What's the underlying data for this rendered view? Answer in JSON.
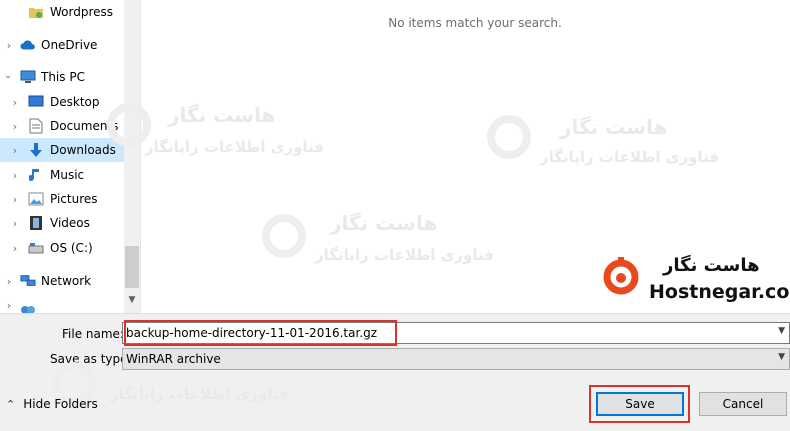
{
  "nav": {
    "items": [
      {
        "label": "Wordpress",
        "icon": "folder-wordpress-icon"
      },
      {
        "label": "OneDrive",
        "icon": "onedrive-cloud-icon"
      },
      {
        "label": "This PC",
        "icon": "computer-icon"
      },
      {
        "label": "Desktop",
        "icon": "desktop-icon"
      },
      {
        "label": "Documents",
        "icon": "documents-icon"
      },
      {
        "label": "Downloads",
        "icon": "downloads-arrow-icon"
      },
      {
        "label": "Music",
        "icon": "music-note-icon"
      },
      {
        "label": "Pictures",
        "icon": "pictures-icon"
      },
      {
        "label": "Videos",
        "icon": "videos-film-icon"
      },
      {
        "label": "OS (C:)",
        "icon": "drive-icon"
      },
      {
        "label": "Network",
        "icon": "network-icon"
      }
    ],
    "selected": "Downloads"
  },
  "content": {
    "empty_message": "No items match your search."
  },
  "watermark": {
    "line1": "هاست نگار",
    "line2": "فناوری اطلاعات رایانگار"
  },
  "brand": {
    "name_fa": "هاست نگار",
    "name_en": "Hostnegar.com",
    "accent": "#e8491d"
  },
  "form": {
    "filename_label": "File name:",
    "filename_value": "backup-home-directory-11-01-2016.tar.gz",
    "type_label": "Save as type:",
    "type_value": "WinRAR archive"
  },
  "footer": {
    "hide_folders_label": "Hide Folders",
    "save_label": "Save",
    "cancel_label": "Cancel"
  },
  "colors": {
    "highlight": "#d9332b",
    "selection": "#cce8ff",
    "focus": "#0078d7"
  }
}
